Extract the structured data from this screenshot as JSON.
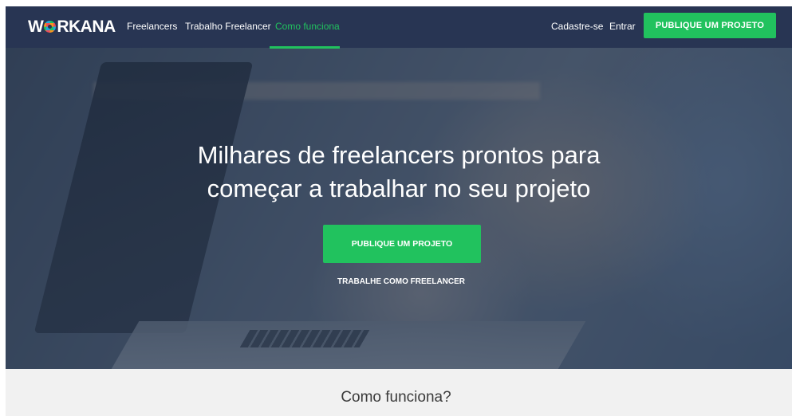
{
  "brand": {
    "logo_prefix": "W",
    "logo_suffix": "RKANA",
    "logo_o_icon": "multicolor-ring-icon"
  },
  "nav": {
    "links": [
      {
        "label": "Freelancers",
        "active": false
      },
      {
        "label": "Trabalho Freelancer",
        "active": false
      },
      {
        "label": "Como funciona",
        "active": true
      }
    ],
    "signup": "Cadastre-se",
    "login": "Entrar",
    "cta": "PUBLIQUE UM PROJETO"
  },
  "hero": {
    "headline_line1": "Milhares de freelancers prontos para",
    "headline_line2": "começar a trabalhar no seu projeto",
    "cta": "PUBLIQUE UM PROJETO",
    "secondary_link": "TRABALHE COMO FREELANCER"
  },
  "section": {
    "title": "Como funciona?"
  },
  "colors": {
    "nav_bg": "#283553",
    "accent_green": "#21c25e",
    "page_bg": "#f1f1f1",
    "text_dark": "#3b3b3b"
  }
}
